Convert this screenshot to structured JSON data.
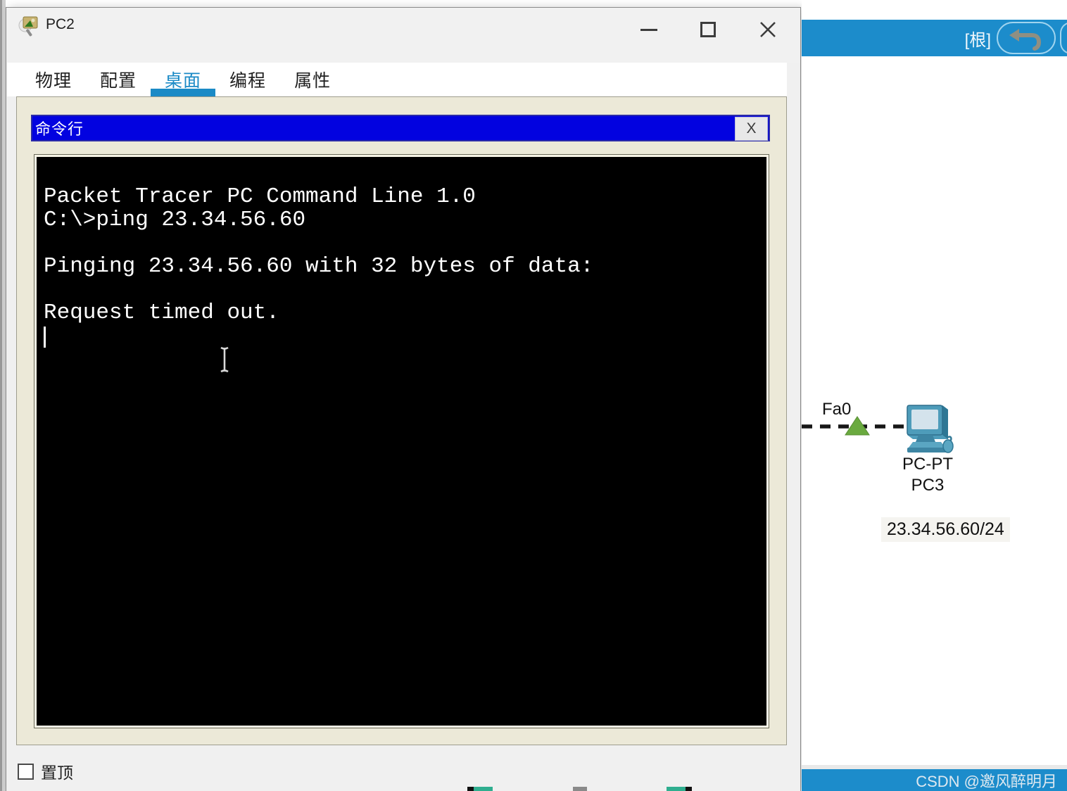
{
  "colors": {
    "toolbar_blue": "#1c8ccb",
    "cmd_header_blue": "#0202e0",
    "terminal_bg": "#000000",
    "terminal_fg": "#ffffff",
    "tab_accent": "#1b8ac6",
    "panel_cream": "#ece9d8",
    "link_green": "#6aaa3f"
  },
  "window": {
    "title": "PC2",
    "tabs": [
      {
        "label": "物理",
        "active": false
      },
      {
        "label": "配置",
        "active": false
      },
      {
        "label": "桌面",
        "active": true
      },
      {
        "label": "编程",
        "active": false
      },
      {
        "label": "属性",
        "active": false
      }
    ],
    "cmd_panel": {
      "title": "命令行",
      "close_label": "X"
    },
    "terminal": {
      "lines": [
        "Packet Tracer PC Command Line 1.0",
        "C:\\>ping 23.34.56.60",
        "",
        "Pinging 23.34.56.60 with 32 bytes of data:",
        "",
        "Request timed out."
      ]
    },
    "pin_checkbox": {
      "label": "置顶",
      "checked": false
    }
  },
  "workspace": {
    "toolbar": {
      "root_label": "[根]"
    },
    "topology": {
      "port_label": "Fa0",
      "device_model": "PC-PT",
      "device_name": "PC3",
      "device_ip": "23.34.56.60/24"
    },
    "watermark": "CSDN @邀风醉明月"
  }
}
